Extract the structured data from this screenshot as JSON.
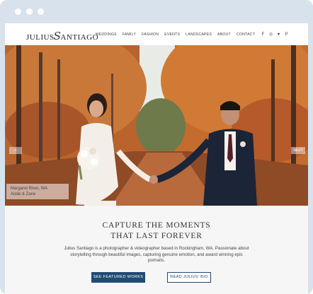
{
  "site": {
    "logo_left": "JULIUS",
    "logo_script": "S",
    "logo_right": "ANTIAGO"
  },
  "nav": {
    "items": [
      "WEDDINGS",
      "FAMILY",
      "FASHION",
      "EVENTS",
      "LANDSCAPES",
      "ABOUT",
      "CONTACT"
    ],
    "social_icons": [
      "facebook-icon",
      "instagram-icon",
      "twitter-icon",
      "pinterest-icon"
    ],
    "social_glyphs": [
      "f",
      "◎",
      "♥",
      "P"
    ]
  },
  "hero": {
    "prev_label": "‹",
    "next_label": "NEXT",
    "caption_line1": "Margaret River, WA",
    "caption_line2": "Aislie & Zane"
  },
  "intro": {
    "headline_line1": "CAPTURE THE MOMENTS",
    "headline_line2": "THAT LAST FOREVER",
    "description": "Julius Santiago is a photographer & videographer based in Rockingham, WA. Passionate about storytelling through beautiful images, capturing genuine emotion, and award winning epic portraits.",
    "primary_button": "SEE FEATURED WORKS",
    "secondary_button": "READ JULIUS' BIO"
  },
  "colors": {
    "frame": "#d8e2ec",
    "accent": "#1f4a72",
    "foliage": "#c9763a"
  }
}
